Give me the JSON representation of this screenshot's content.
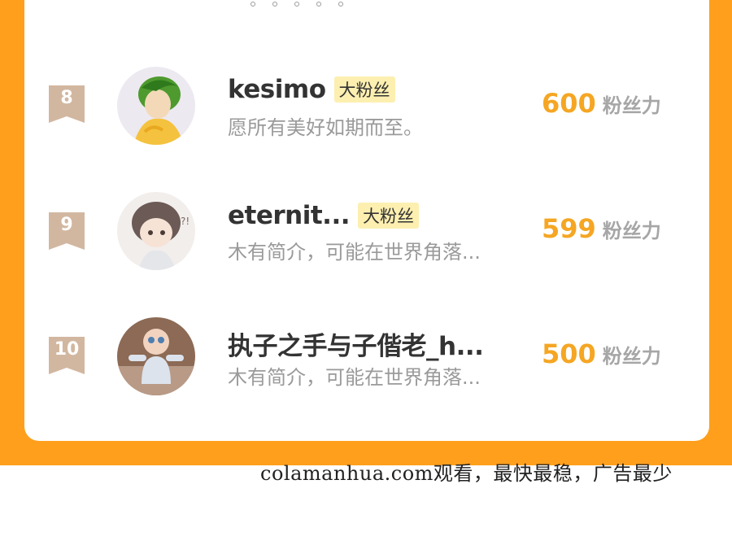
{
  "colors": {
    "frame": "#FF9F1C",
    "score": "#F5A623",
    "badge": "#D2B7A0",
    "tag_bg": "#FCEFB0"
  },
  "pager": {
    "dots": 5
  },
  "rankings": [
    {
      "rank": "8",
      "name": "kesimo",
      "tag": "大粉丝",
      "bio": "愿所有美好如期而至。",
      "score": "600",
      "score_unit": "粉丝力",
      "avatar_icon": "green-haired-character-avatar"
    },
    {
      "rank": "9",
      "name": "eternit...",
      "tag": "大粉丝",
      "bio": "木有简介，可能在世界角落...",
      "score": "599",
      "score_unit": "粉丝力",
      "avatar_icon": "chibi-character-avatar"
    },
    {
      "rank": "10",
      "name": "执子之手与子偕老_h...",
      "tag": "",
      "bio": "木有简介，可能在世界角落...",
      "score": "500",
      "score_unit": "粉丝力",
      "avatar_icon": "baby-photo-avatar"
    }
  ],
  "watermark": "colamanhua.com观看，最快最稳，广告最少"
}
